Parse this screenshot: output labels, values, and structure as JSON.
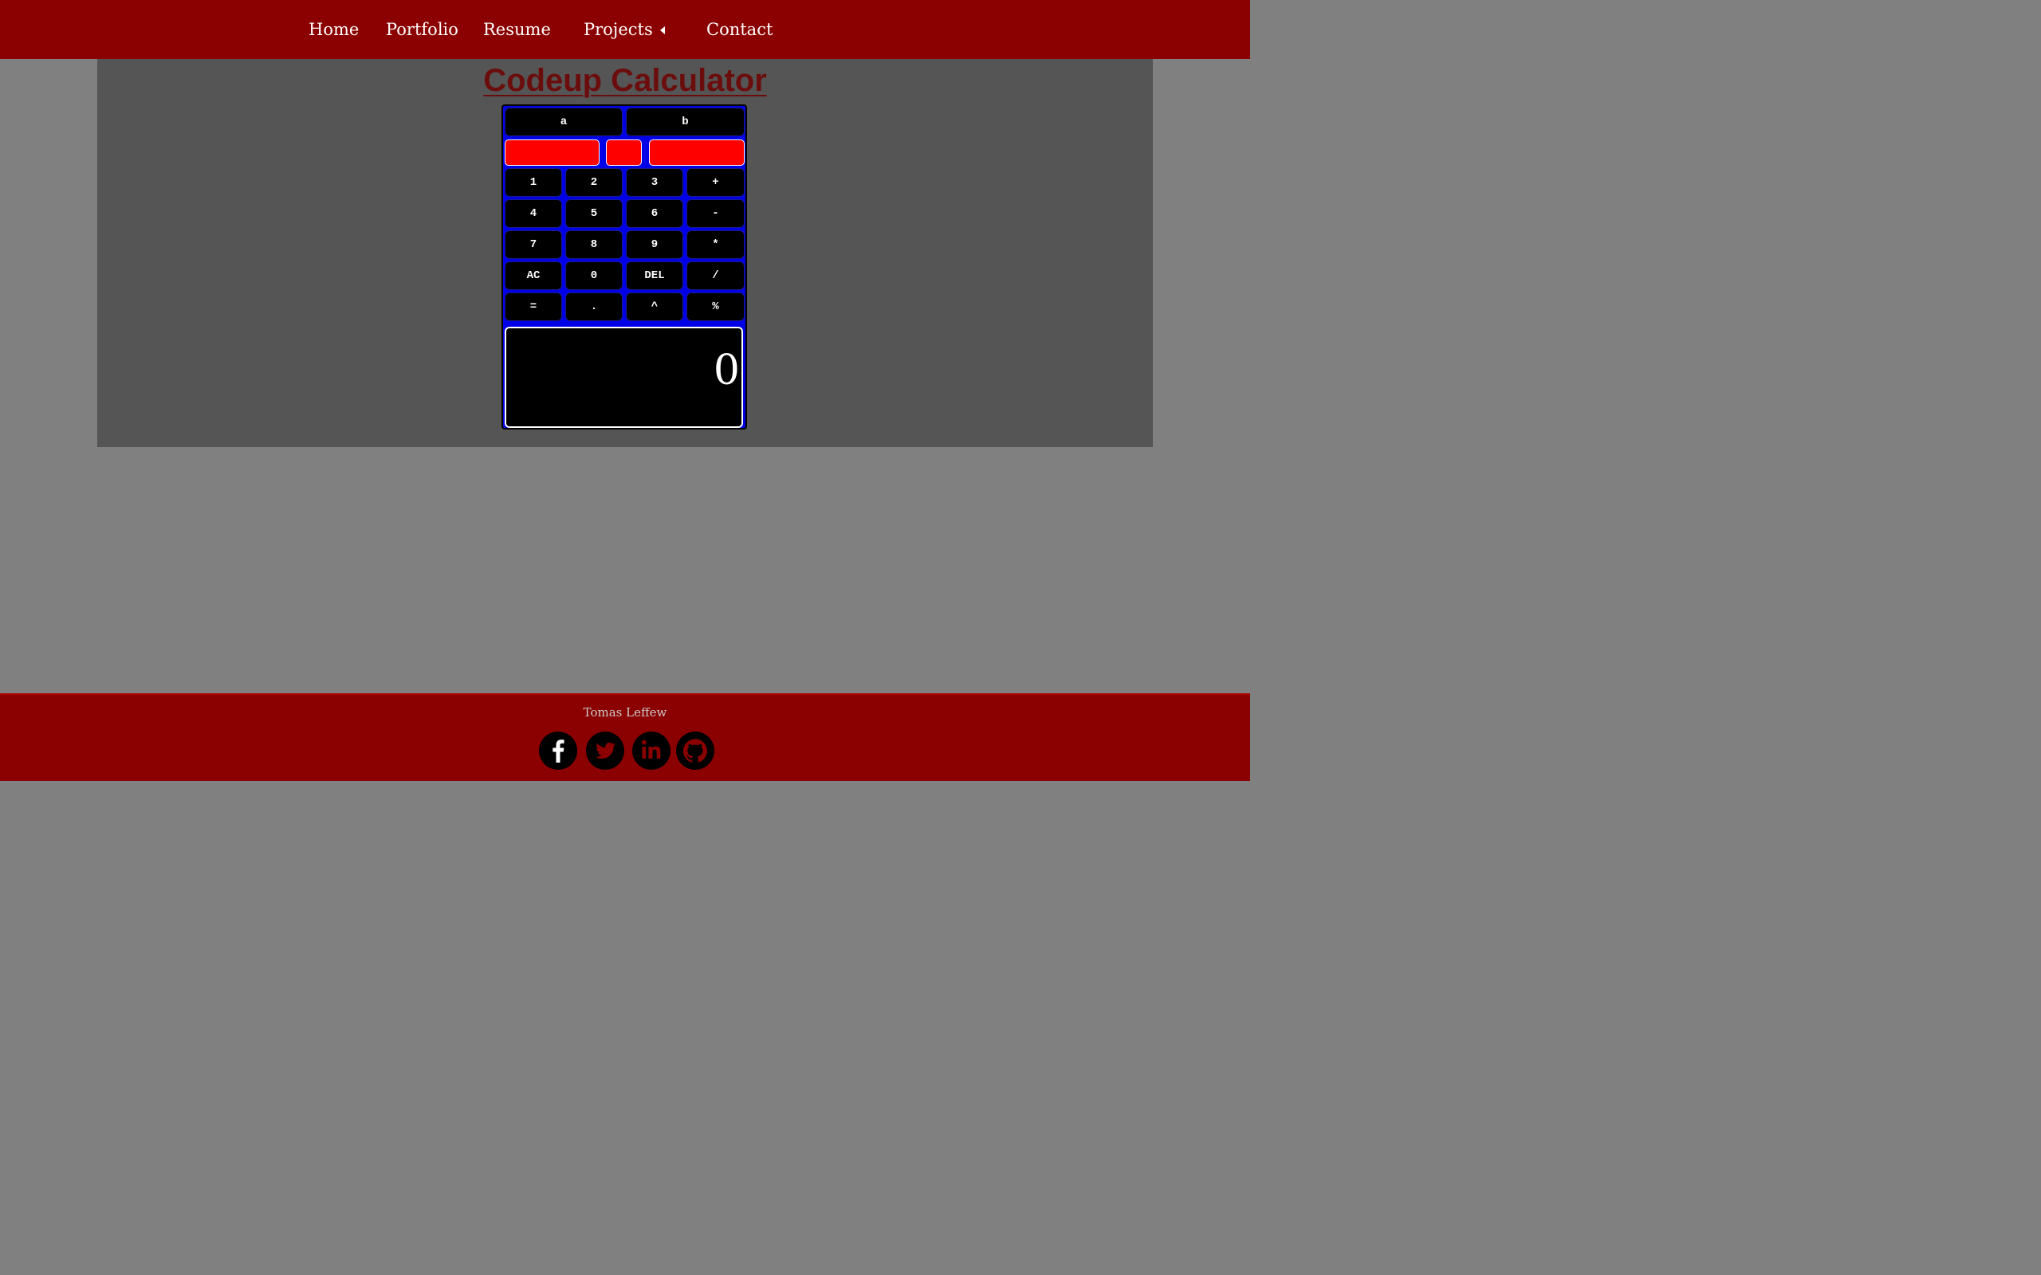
{
  "nav": {
    "items": [
      {
        "label": "Home"
      },
      {
        "label": "Portfolio"
      },
      {
        "label": "Resume"
      },
      {
        "label": "Projects"
      },
      {
        "label": "Contact"
      }
    ]
  },
  "page": {
    "title": "Codeup Calculator"
  },
  "calculator": {
    "top_buttons": [
      "a",
      "b"
    ],
    "inputs": {
      "left_value": "",
      "operator_value": "",
      "right_value": ""
    },
    "keys": [
      [
        "1",
        "2",
        "3",
        "+"
      ],
      [
        "4",
        "5",
        "6",
        "-"
      ],
      [
        "7",
        "8",
        "9",
        "*"
      ],
      [
        "AC",
        "0",
        "DEL",
        "/"
      ],
      [
        "=",
        ".",
        "^",
        "%"
      ]
    ],
    "display_value": "0"
  },
  "footer": {
    "name": "Tomas Leffew",
    "social": [
      {
        "icon": "facebook-icon"
      },
      {
        "icon": "twitter-icon"
      },
      {
        "icon": "linkedin-icon"
      },
      {
        "icon": "github-icon"
      }
    ]
  },
  "colors": {
    "nav_background": "#8b0000",
    "page_background": "#808080",
    "panel_background": "#555555",
    "title_color": "#6b0d0d",
    "calculator_background": "#0000e6",
    "key_background": "#000000",
    "input_background": "#ff0000"
  }
}
